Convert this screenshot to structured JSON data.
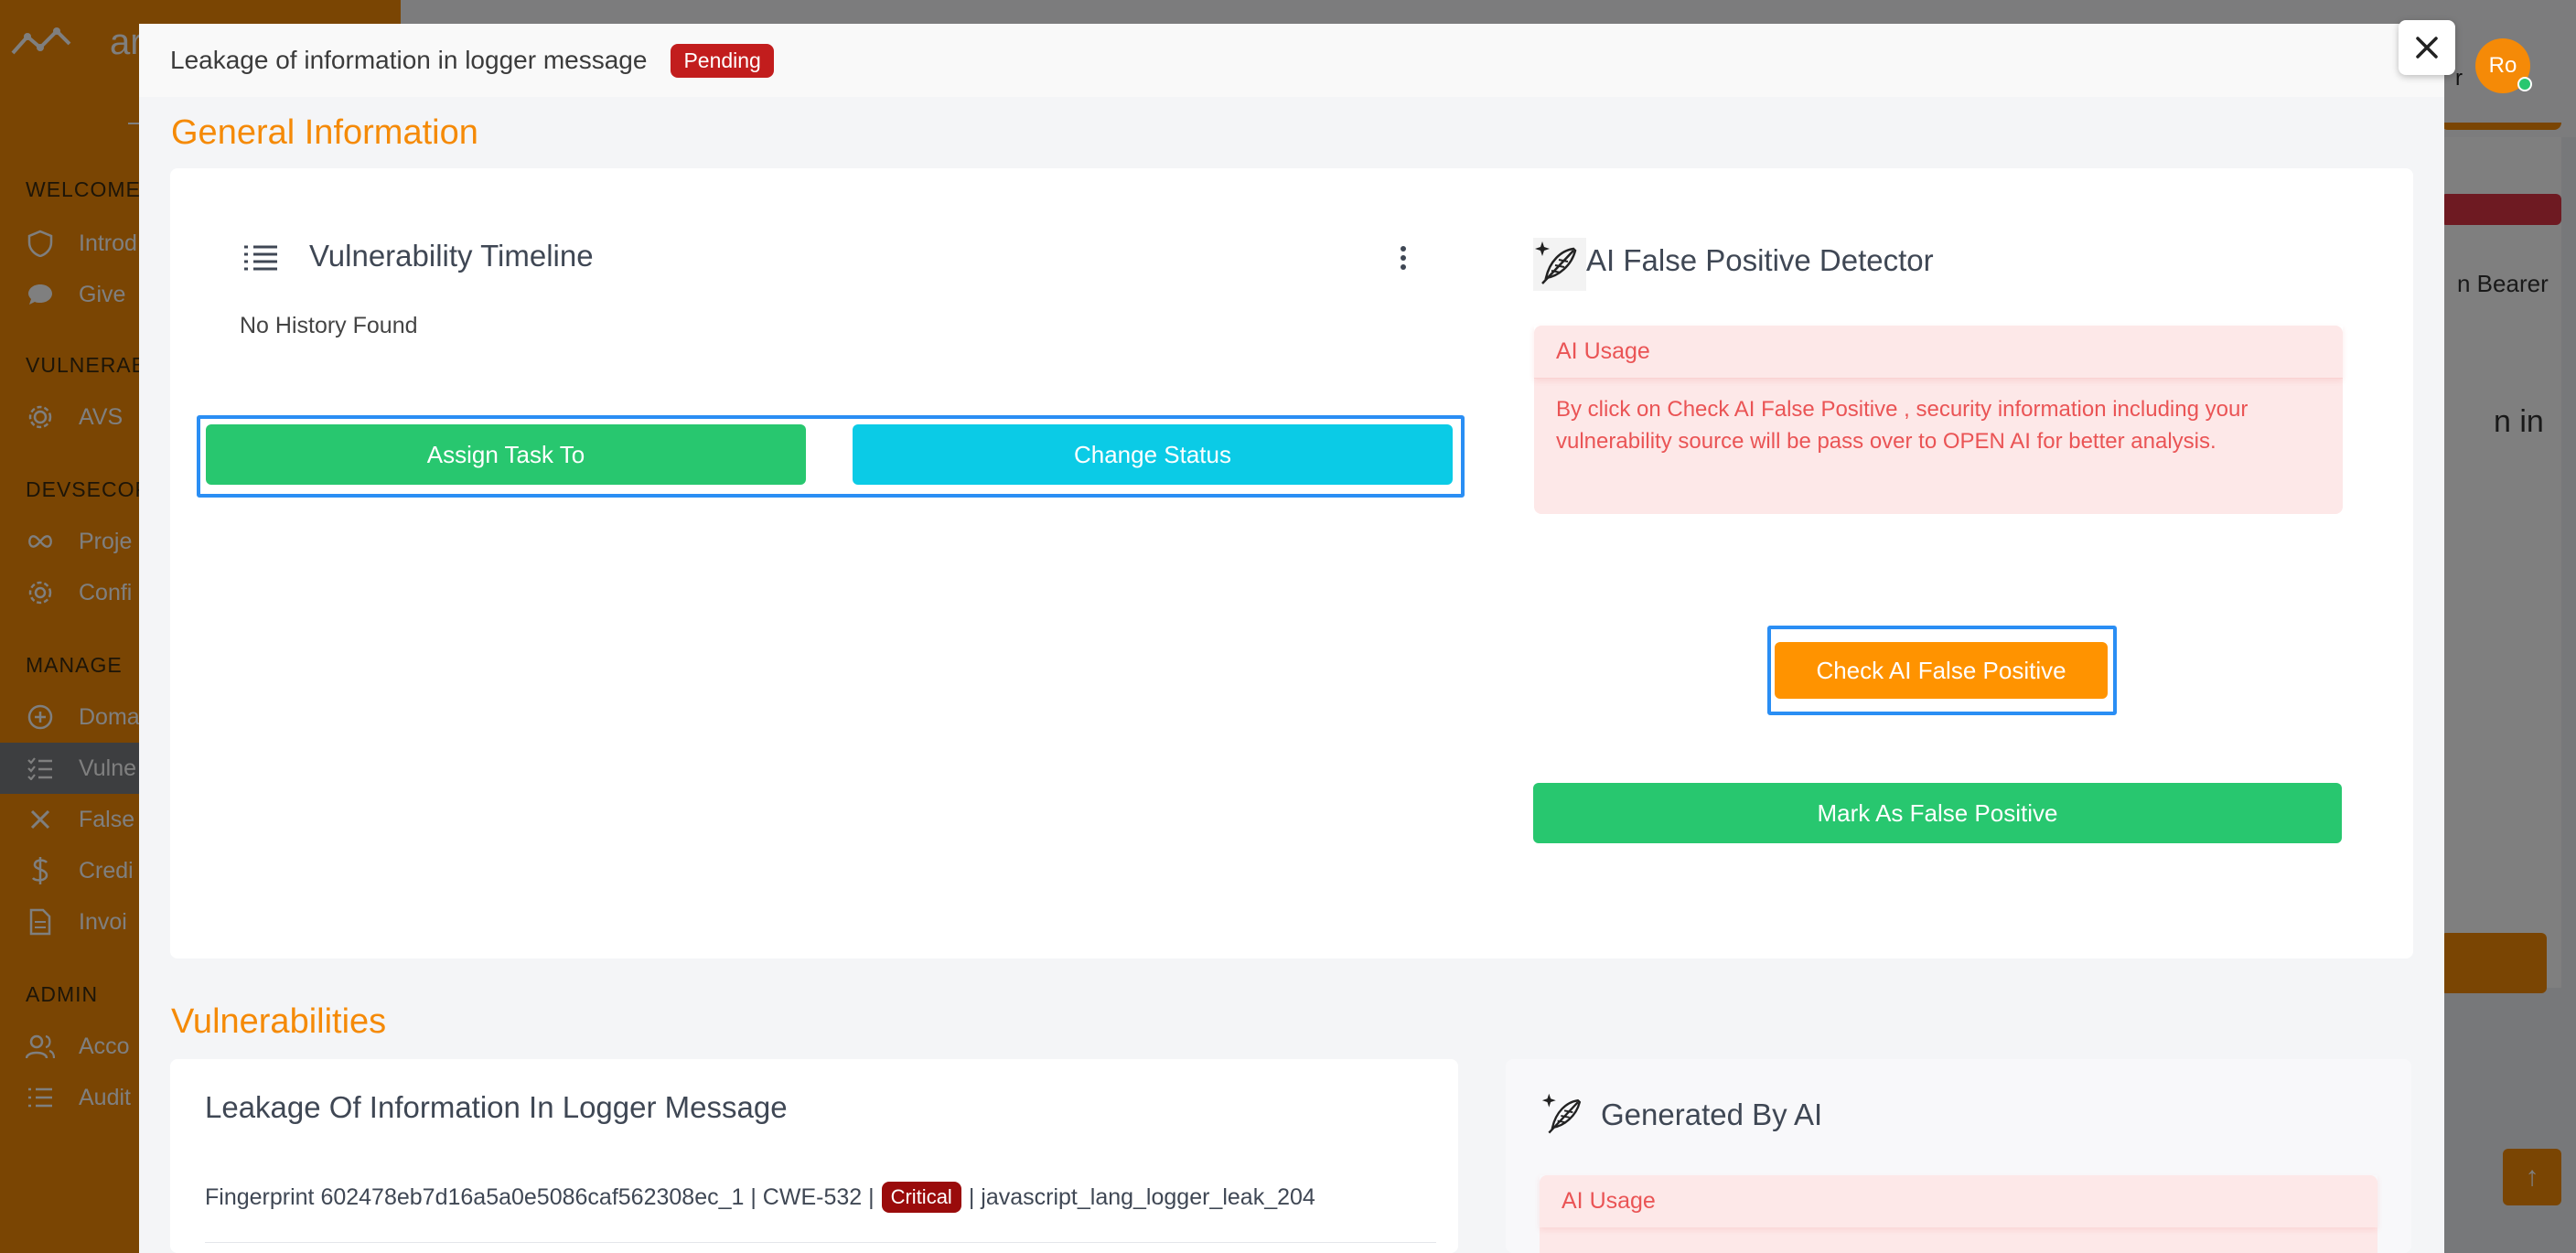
{
  "background": {
    "brand": "arr",
    "sidebar_sections": [
      "WELCOME",
      "VULNERAB",
      "DEVSECOP",
      "MANAGE",
      "ADMIN"
    ],
    "sidebar_items": [
      "Introd",
      "Give",
      "AVS",
      "Proje",
      "Confi",
      "Doma",
      "Vulne",
      "False",
      "Credi",
      "Invoi",
      "Acco",
      "Audit"
    ],
    "right_text_1": "n Bearer",
    "right_text_2": "n in",
    "avatar_initials": "Ro",
    "topbar_glyph": "r",
    "scroll_top": "↑"
  },
  "modal": {
    "title": "Leakage of information in logger message",
    "status_badge": "Pending",
    "close": "✕",
    "general_information": {
      "heading": "General Information",
      "timeline": {
        "title": "Vulnerability Timeline",
        "empty_text": "No History Found"
      },
      "assign_button": "Assign Task To",
      "change_status_button": "Change Status",
      "ai_detector": {
        "title": "AI False Positive Detector",
        "alert_heading": "AI Usage",
        "alert_body": "By click on Check AI False Positive , security information including your vulnerability source will be pass over to OPEN AI for better analysis.",
        "check_button": "Check AI False Positive",
        "mark_button": "Mark As False Positive"
      }
    },
    "vulnerabilities": {
      "heading": "Vulnerabilities",
      "title": "Leakage Of Information In Logger Message",
      "fingerprint": "Fingerprint 602478eb7d16a5a0e5086caf562308ec_1 | CWE-532 |",
      "severity": "Critical",
      "rule_id": "| javascript_lang_logger_leak_204"
    },
    "generated": {
      "title": "Generated By AI",
      "alert_heading": "AI Usage"
    }
  },
  "colors": {
    "accent": "#f58a07",
    "success": "#28c76f",
    "info": "#0bcbe6",
    "danger": "#c21d1d",
    "focus": "#2a8ef4",
    "alert_bg": "#fde8e8",
    "alert_text": "#ea5455"
  },
  "icons": [
    "shield-icon",
    "chat-icon",
    "gear-icon",
    "infinity-icon",
    "plus-circle-icon",
    "list-check-icon",
    "x-icon",
    "dollar-icon",
    "document-icon",
    "users-icon",
    "list-icon",
    "timeline-list-icon",
    "kebab-menu-icon",
    "ai-feather-icon",
    "close-icon",
    "arrow-up-icon"
  ]
}
